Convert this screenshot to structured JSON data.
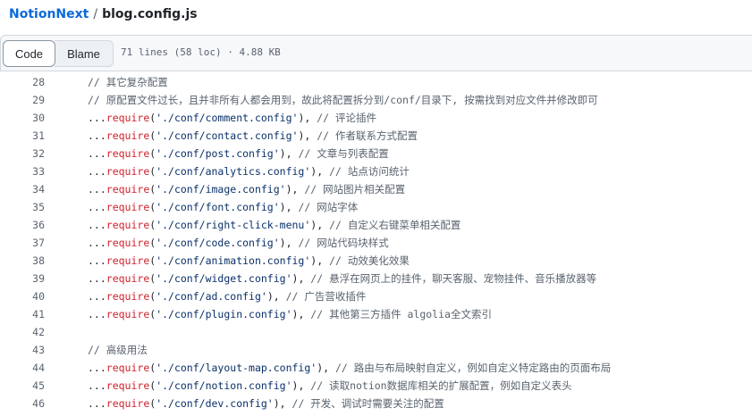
{
  "breadcrumb": {
    "repo": "NotionNext",
    "separator": "/",
    "file": "blog.config.js"
  },
  "toolbar": {
    "code_label": "Code",
    "blame_label": "Blame",
    "meta": "71 lines (58 loc) · 4.88 KB"
  },
  "lines": [
    {
      "num": "28",
      "comment": "// 其它复杂配置"
    },
    {
      "num": "29",
      "comment": "// 原配置文件过长，且并非所有人都会用到，故此将配置拆分到/conf/目录下, 按需找到对应文件并修改即可"
    },
    {
      "num": "30",
      "spread": "...",
      "kw": "require",
      "str": "'./conf/comment.config'",
      "tail": "), ",
      "comment": "// 评论插件"
    },
    {
      "num": "31",
      "spread": "...",
      "kw": "require",
      "str": "'./conf/contact.config'",
      "tail": "), ",
      "comment": "// 作者联系方式配置"
    },
    {
      "num": "32",
      "spread": "...",
      "kw": "require",
      "str": "'./conf/post.config'",
      "tail": "), ",
      "comment": "// 文章与列表配置"
    },
    {
      "num": "33",
      "spread": "...",
      "kw": "require",
      "str": "'./conf/analytics.config'",
      "tail": "), ",
      "comment": "// 站点访问统计"
    },
    {
      "num": "34",
      "spread": "...",
      "kw": "require",
      "str": "'./conf/image.config'",
      "tail": "), ",
      "comment": "// 网站图片相关配置"
    },
    {
      "num": "35",
      "spread": "...",
      "kw": "require",
      "str": "'./conf/font.config'",
      "tail": "), ",
      "comment": "// 网站字体"
    },
    {
      "num": "36",
      "spread": "...",
      "kw": "require",
      "str": "'./conf/right-click-menu'",
      "tail": "), ",
      "comment": "// 自定义右键菜单相关配置"
    },
    {
      "num": "37",
      "spread": "...",
      "kw": "require",
      "str": "'./conf/code.config'",
      "tail": "), ",
      "comment": "// 网站代码块样式"
    },
    {
      "num": "38",
      "spread": "...",
      "kw": "require",
      "str": "'./conf/animation.config'",
      "tail": "), ",
      "comment": "// 动效美化效果"
    },
    {
      "num": "39",
      "spread": "...",
      "kw": "require",
      "str": "'./conf/widget.config'",
      "tail": "), ",
      "comment": "// 悬浮在网页上的挂件，聊天客服、宠物挂件、音乐播放器等"
    },
    {
      "num": "40",
      "spread": "...",
      "kw": "require",
      "str": "'./conf/ad.config'",
      "tail": "), ",
      "comment": "// 广告营收插件"
    },
    {
      "num": "41",
      "spread": "...",
      "kw": "require",
      "str": "'./conf/plugin.config'",
      "tail": "), ",
      "comment": "// 其他第三方插件 algolia全文索引"
    },
    {
      "num": "42"
    },
    {
      "num": "43",
      "comment": "// 高级用法"
    },
    {
      "num": "44",
      "spread": "...",
      "kw": "require",
      "str": "'./conf/layout-map.config'",
      "tail": "), ",
      "comment": "// 路由与布局映射自定义，例如自定义特定路由的页面布局"
    },
    {
      "num": "45",
      "spread": "...",
      "kw": "require",
      "str": "'./conf/notion.config'",
      "tail": "), ",
      "comment": "// 读取notion数据库相关的扩展配置，例如自定义表头"
    },
    {
      "num": "46",
      "spread": "...",
      "kw": "require",
      "str": "'./conf/dev.config'",
      "tail": "), ",
      "comment": "// 开发、调试时需要关注的配置"
    }
  ]
}
